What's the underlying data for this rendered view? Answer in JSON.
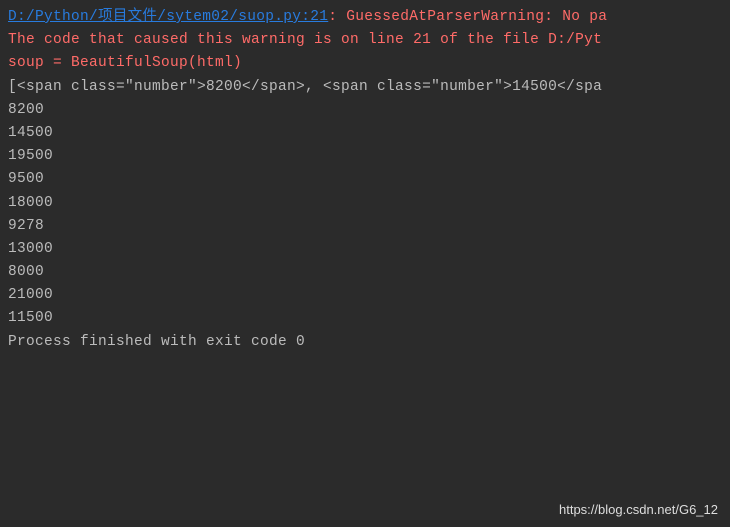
{
  "console": {
    "file_link": "D:/Python/项目文件/sytem02/suop.py:21",
    "warning_head": ": GuessedAtParserWarning: No pa",
    "warning_body": "The code that caused this warning is on line 21 of the file D:/Pyt",
    "warning_code": "  soup = BeautifulSoup(html)",
    "span_output": "[<span class=\"number\">8200</span>, <span class=\"number\">14500</spa",
    "numbers": [
      "8200",
      "14500",
      "19500",
      "9500",
      "18000",
      "9278",
      "13000",
      "8000",
      "21000",
      "11500"
    ],
    "exit_message": "Process finished with exit code 0"
  },
  "watermark": "https://blog.csdn.net/G6_12"
}
